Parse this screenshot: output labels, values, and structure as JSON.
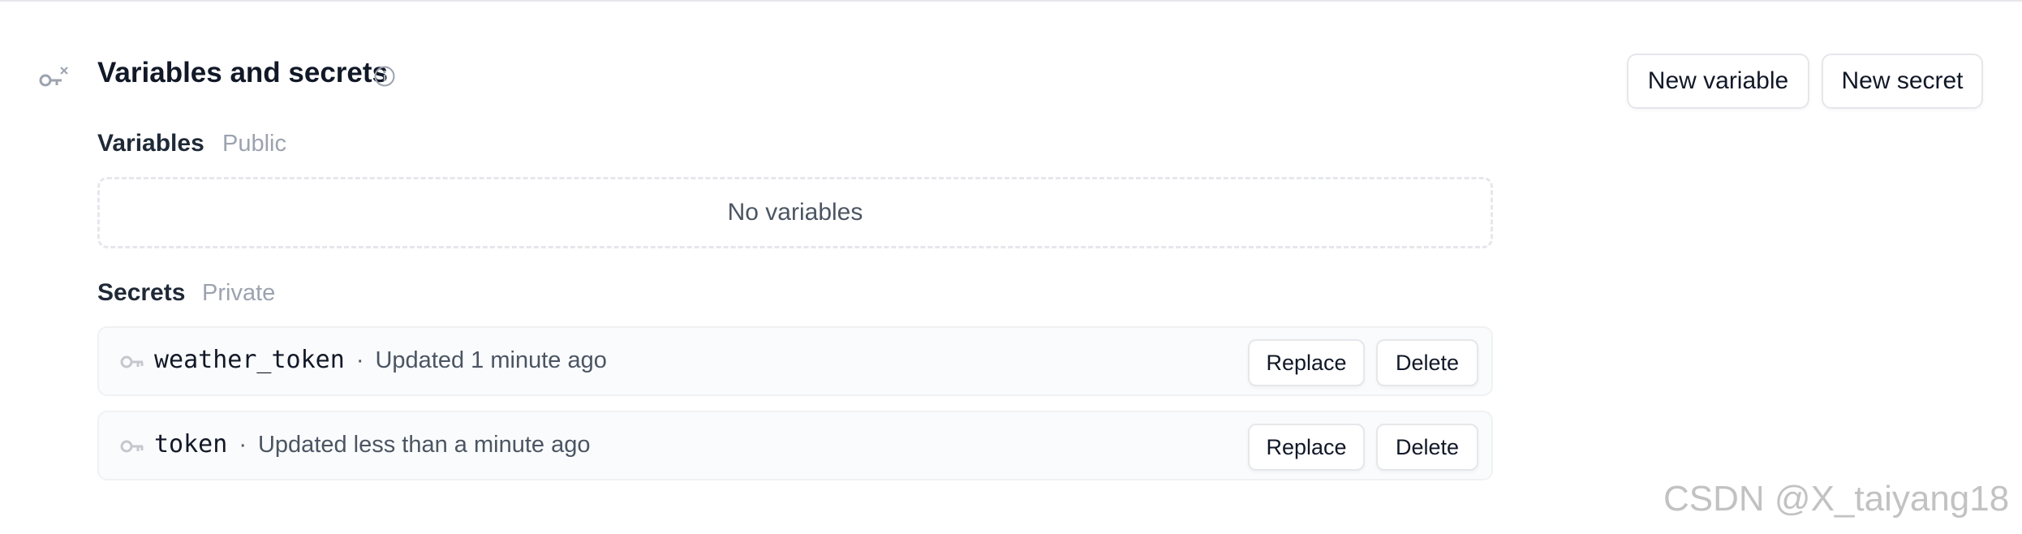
{
  "section": {
    "title": "Variables and secrets",
    "icon": "wand-icon",
    "info_icon": "info-icon"
  },
  "header_actions": {
    "new_variable_label": "New variable",
    "new_secret_label": "New secret"
  },
  "variables": {
    "heading": "Variables",
    "visibility": "Public",
    "empty_text": "No variables"
  },
  "secrets": {
    "heading": "Secrets",
    "visibility": "Private",
    "items": [
      {
        "name": "weather_token",
        "separator": "·",
        "updated": "Updated 1 minute ago",
        "replace_label": "Replace",
        "delete_label": "Delete"
      },
      {
        "name": "token",
        "separator": "·",
        "updated": "Updated less than a minute ago",
        "replace_label": "Replace",
        "delete_label": "Delete"
      }
    ]
  },
  "watermark": "CSDN @X_taiyang18",
  "colors": {
    "text_primary": "#111827",
    "text_muted": "#4b5563",
    "text_tag": "#9ca3af",
    "border": "#e5e7eb",
    "row_background": "#fafbfc"
  }
}
